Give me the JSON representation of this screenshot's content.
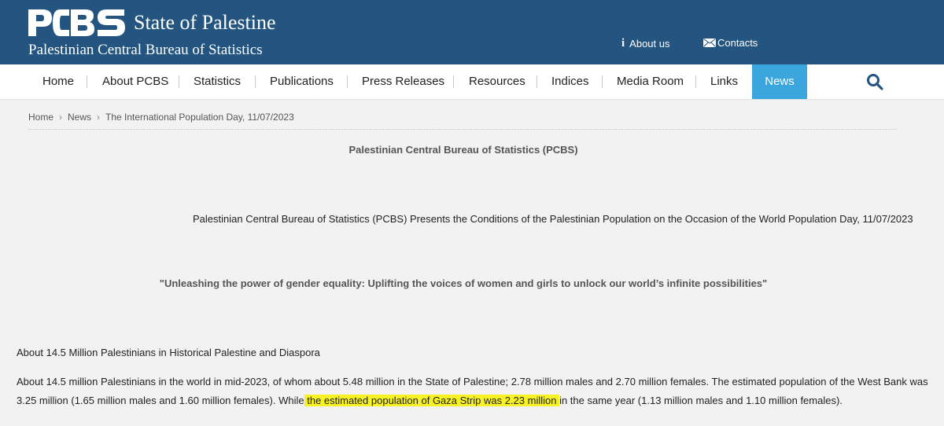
{
  "header": {
    "logo_text": "PCBS",
    "state_name": "State of Palestine",
    "org_name": "Palestinian Central Bureau of Statistics",
    "about_label": "About us",
    "contacts_label": "Contacts",
    "background_color": "#235580"
  },
  "nav": {
    "items": [
      "Home",
      "About PCBS",
      "Statistics",
      "Publications",
      "Press Releases",
      "Resources",
      "Indices",
      "Media Room",
      "Links",
      "News"
    ],
    "active": "News",
    "active_color": "#3aa6dd",
    "search_icon": "search-icon"
  },
  "breadcrumb": {
    "items": [
      "Home",
      "News",
      "The International Population Day, 11/07/2023"
    ]
  },
  "content": {
    "org_title": "Palestinian Central Bureau of Statistics (PCBS)",
    "release_title": "Palestinian Central Bureau of Statistics (PCBS) Presents the Conditions of the Palestinian Population on the Occasion of the World Population Day, 11/07/2023",
    "theme_quote": "\"Unleashing the power of gender equality: Uplifting the voices of women and girls to unlock our world’s infinite possibilities\"",
    "section_heading": "About 14.5 Million Palestinians in Historical Palestine and Diaspora",
    "paragraph_before": "About 14.5 million Palestinians in the world in mid-2023, of whom about 5.48 million in the State of Palestine; 2.78 million males and 2.70 million females. The estimated population of the West Bank was 3.25 million (1.65 million males and 1.60 million females). While",
    "paragraph_highlight": " the estimated population of Gaza Strip was 2.23 million ",
    "paragraph_after": "in the same year (1.13 million males and 1.10 million females).",
    "highlight_color": "#f7f226"
  }
}
